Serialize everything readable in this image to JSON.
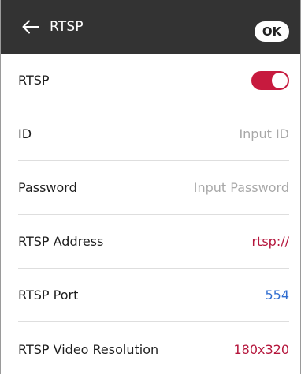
{
  "header": {
    "title": "RTSP",
    "ok_label": "OK",
    "back_icon": "arrow-left-icon"
  },
  "rows": {
    "rtsp": {
      "label": "RTSP",
      "enabled": true,
      "toggle_color": "#c71a3e"
    },
    "id": {
      "label": "ID",
      "value": "",
      "placeholder": "Input ID"
    },
    "password": {
      "label": "Password",
      "value": "",
      "placeholder": "Input Password"
    },
    "address": {
      "label": "RTSP Address",
      "value": "rtsp://",
      "color": "#b5173d"
    },
    "port": {
      "label": "RTSP Port",
      "value": "554",
      "color": "#2f6dd0"
    },
    "resolution": {
      "label": "RTSP Video Resolution",
      "value": "180x320",
      "color": "#b5173d"
    }
  },
  "colors": {
    "header_bg": "#333333",
    "accent": "#b5173d",
    "link_blue": "#2f6dd0",
    "placeholder_gray": "#a8a8a8"
  }
}
